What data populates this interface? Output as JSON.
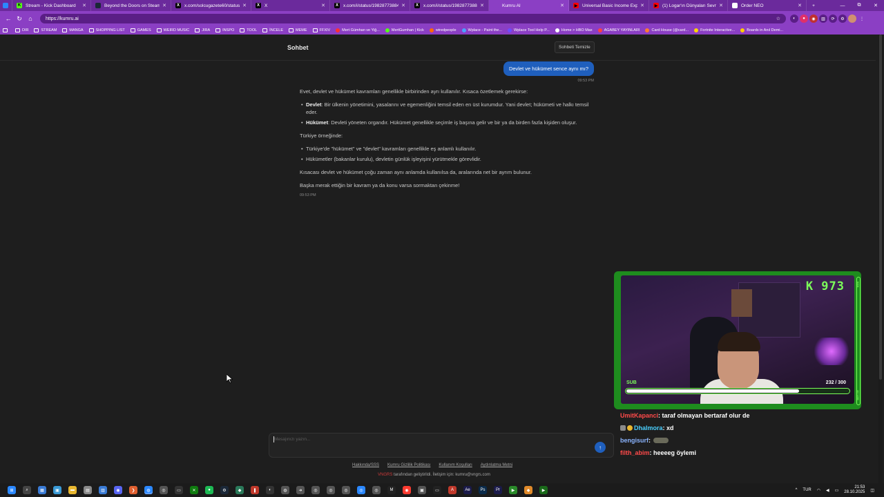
{
  "browser": {
    "tabs": [
      {
        "title": "Stream - Kick Dashboard",
        "fav": "K",
        "color": "#53fc18",
        "w": 114
      },
      {
        "title": "Beyond the Doors on Steam",
        "fav": "",
        "color": "#1b2838",
        "w": 116
      },
      {
        "title": "x.com/solcugazete60/status/19...",
        "fav": "X",
        "color": "#000000",
        "w": 116
      },
      {
        "title": "X",
        "fav": "X",
        "color": "#000000",
        "w": 114
      },
      {
        "title": "x.com/i/status/19828773884904",
        "fav": "X",
        "color": "#000000",
        "w": 116
      },
      {
        "title": "x.com/i/status/19828773884904",
        "fav": "X",
        "color": "#000000",
        "w": 114
      },
      {
        "title": "Kumru AI",
        "fav": "",
        "color": "#8b3fc4",
        "w": 116,
        "active": true
      },
      {
        "title": "Universal Basic Income Explaine...",
        "fav": "▶",
        "color": "#ff0000",
        "w": 116
      },
      {
        "title": "(1) Logar'ın Dünyaları Sevmem...",
        "fav": "▶",
        "color": "#ff0000",
        "w": 114
      },
      {
        "title": "Order NEO",
        "fav": "",
        "color": "#ffffff",
        "w": 114
      }
    ],
    "new_tab": "+",
    "window": {
      "minimize": "—",
      "maximize": "⧉",
      "close": "✕"
    },
    "url": "https://kumru.ai",
    "nav": {
      "back": "←",
      "reload": "↻",
      "home": "⌂"
    },
    "star": "☆",
    "bookmarks": [
      {
        "label": "DIR",
        "type": "folder"
      },
      {
        "label": "STREAM",
        "type": "folder"
      },
      {
        "label": "MANGA",
        "type": "folder"
      },
      {
        "label": "SHOPPING LIST",
        "type": "folder"
      },
      {
        "label": "GAMES",
        "type": "folder"
      },
      {
        "label": "WEIRD MUSIC",
        "type": "folder"
      },
      {
        "label": "JIRA",
        "type": "folder"
      },
      {
        "label": "INSPO",
        "type": "folder"
      },
      {
        "label": "TOOL",
        "type": "folder"
      },
      {
        "label": "İNCELE",
        "type": "folder"
      },
      {
        "label": "MEME",
        "type": "folder"
      },
      {
        "label": "FFXIV",
        "type": "folder"
      },
      {
        "label": "Mert Gümhan ve Yiğ...",
        "type": "site",
        "color": "#ff3030"
      },
      {
        "label": "MertGumhan | Kick",
        "type": "site",
        "color": "#53fc18"
      },
      {
        "label": "wiredpeople",
        "type": "site",
        "color": "#ff6a00"
      },
      {
        "label": "Wplace - Paint the...",
        "type": "site",
        "color": "#4aa3ff"
      },
      {
        "label": "Wplace Tool Help P...",
        "type": "site",
        "color": "#6c4cff"
      },
      {
        "label": "Home > HBO Max",
        "type": "site",
        "color": "#ffffff"
      },
      {
        "label": "AGABEY YAYINLARI",
        "type": "site",
        "color": "#ff4040"
      },
      {
        "label": "Card House (@card...",
        "type": "site",
        "color": "#ff7a30"
      },
      {
        "label": "Fortnite Interactive...",
        "type": "site",
        "color": "#ffd400"
      },
      {
        "label": "Boards in Anıl Demi...",
        "type": "site",
        "color": "#ffcc00"
      }
    ]
  },
  "page": {
    "header_title": "Sohbet",
    "clear_button": "Sohbeti Temizle",
    "user_message": "Devlet ve hükümet sence aynı mı?",
    "user_time": "09:53 PM",
    "bot": {
      "intro": "Evet, devlet ve hükümet kavramları genellikle birbirinden ayrı kullanılır. Kısaca özetlemek gerekirse:",
      "items": [
        {
          "term": "Devlet",
          "text": ": Bir ülkenin yönetimini, yasalarını ve egemenliğini temsil eden en üst kurumdur. Yani devlet; hükümeti ve halkı temsil eder."
        },
        {
          "term": "Hükümet",
          "text": ": Devleti yöneten organdır. Hükümet genellikle seçimle iş başına gelir ve bir ya da birden fazla kişiden oluşur."
        }
      ],
      "example_heading": "Türkiye örneğinde:",
      "examples": [
        "Türkiye'de \"hükümet\" ve \"devlet\" kavramları genellikle eş anlamlı kullanılır.",
        "Hükümetler (bakanlar kurulu), devletin günlük işleyişini yürütmekle görevlidir."
      ],
      "summary": "Kısacası devlet ve hükümet çoğu zaman aynı anlamda kullanılsa da, aralarında net bir ayrım bulunur.",
      "closing": "Başka merak ettiğin bir kavram ya da konu varsa sormaktan çekinme!",
      "time": "09:53 PM"
    },
    "composer_placeholder": "Mesajınızı yazın...",
    "send_icon": "↑",
    "footer_links": [
      "Hakkında/SSS",
      "Kumru Gizlilik Politikası",
      "Kullanım Koşulları",
      "Aydınlatma Metni"
    ],
    "footer_brand": "VNGRS",
    "footer_text": " tarafından geliştirildi. İletişim için: kumru@vngrs.com"
  },
  "overlay": {
    "kick_count": "K 973",
    "sub_label": "SUB",
    "sub_count": "232  / 300",
    "sub_progress": 0.773,
    "side_top": "KICK",
    "side_bottom": "10 / 1000",
    "chat": [
      {
        "user": "UmitKapanci",
        "color": "#ff4a4a",
        "message": " : taraf olmayan bertaraf olur de"
      },
      {
        "user": "Dhalmora",
        "color": "#4ad0ff",
        "message": " : xd",
        "badges": true
      },
      {
        "user": "bengisurf",
        "color": "#8ab4ff",
        "message": " :",
        "emote": true
      },
      {
        "user": "filth_abim",
        "color": "#ff4a4a",
        "message": " : heeeeg öylemi"
      }
    ]
  },
  "taskbar": {
    "apps": [
      {
        "name": "windows-start-icon",
        "glyph": "⊞",
        "color": "#2b88ff"
      },
      {
        "name": "search-icon",
        "glyph": "⌕",
        "color": "#444"
      },
      {
        "name": "widgets-icon",
        "glyph": "▦",
        "color": "#3a7bd5"
      },
      {
        "name": "photos-icon",
        "glyph": "▣",
        "color": "#3a9ad5"
      },
      {
        "name": "folder-icon",
        "glyph": "▬",
        "color": "#e8b730"
      },
      {
        "name": "notes-icon",
        "glyph": "▤",
        "color": "#8a8a8a"
      },
      {
        "name": "document-icon",
        "glyph": "▥",
        "color": "#3a7bd5"
      },
      {
        "name": "discord-icon",
        "glyph": "◉",
        "color": "#5865f2"
      },
      {
        "name": "vscode-icon",
        "glyph": "❯",
        "color": "#e06030"
      },
      {
        "name": "browser-icon",
        "glyph": "◍",
        "color": "#2b88ff",
        "active": true
      },
      {
        "name": "obs-icon",
        "glyph": "◎",
        "color": "#555"
      },
      {
        "name": "terminal-icon",
        "glyph": "▭",
        "color": "#333"
      },
      {
        "name": "xbox-icon",
        "glyph": "✕",
        "color": "#107c10"
      },
      {
        "name": "spotify-icon",
        "glyph": "●",
        "color": "#1db954"
      },
      {
        "name": "steam-icon",
        "glyph": "⚙",
        "color": "#1b2838"
      },
      {
        "name": "app-icon-1",
        "glyph": "◆",
        "color": "#2a7a5a"
      },
      {
        "name": "app-icon-2",
        "glyph": "❚",
        "color": "#c0392b"
      },
      {
        "name": "app-icon-3",
        "glyph": "◐",
        "color": "#333"
      },
      {
        "name": "app-icon-4",
        "glyph": "◍",
        "color": "#555"
      },
      {
        "name": "app-icon-5",
        "glyph": "➜",
        "color": "#555"
      },
      {
        "name": "app-icon-6",
        "glyph": "◎",
        "color": "#555"
      },
      {
        "name": "app-icon-7",
        "glyph": "◎",
        "color": "#555"
      },
      {
        "name": "app-icon-8",
        "glyph": "◎",
        "color": "#555"
      },
      {
        "name": "app-icon-9",
        "glyph": "◎",
        "color": "#2b88ff"
      },
      {
        "name": "app-icon-10",
        "glyph": "◎",
        "color": "#555"
      },
      {
        "name": "app-icon-11",
        "glyph": "M",
        "color": "#222"
      },
      {
        "name": "app-icon-12",
        "glyph": "◉",
        "color": "#ff3b30"
      },
      {
        "name": "app-icon-13",
        "glyph": "▣",
        "color": "#555"
      },
      {
        "name": "app-icon-14",
        "glyph": "▭",
        "color": "#222"
      },
      {
        "name": "app-icon-15",
        "glyph": "A",
        "color": "#c0392b"
      },
      {
        "name": "after-effects-icon",
        "glyph": "Ae",
        "color": "#1a1a4a"
      },
      {
        "name": "photoshop-icon",
        "glyph": "Ps",
        "color": "#0a2a4a"
      },
      {
        "name": "premiere-icon",
        "glyph": "Pr",
        "color": "#1a1a4a"
      },
      {
        "name": "app-icon-16",
        "glyph": "▶",
        "color": "#2a8a2a"
      },
      {
        "name": "app-icon-17",
        "glyph": "◆",
        "color": "#e08a2a"
      },
      {
        "name": "app-icon-18",
        "glyph": "▶",
        "color": "#1a6a1a"
      }
    ],
    "tray": {
      "chevron": "^",
      "lang": "TUR",
      "time": "21:53",
      "date": "28.10.2025"
    }
  }
}
